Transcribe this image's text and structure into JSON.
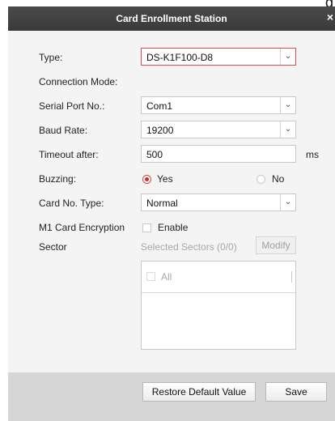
{
  "corner_glyph": "g",
  "dialog": {
    "title": "Card Enrollment Station",
    "close_glyph": "×"
  },
  "form": {
    "type": {
      "label": "Type:",
      "value": "DS-K1F100-D8"
    },
    "connection_mode": {
      "label": "Connection Mode:"
    },
    "serial_port": {
      "label": "Serial Port No.:",
      "value": "Com1"
    },
    "baud_rate": {
      "label": "Baud Rate:",
      "value": "19200"
    },
    "timeout": {
      "label": "Timeout after:",
      "value": "500",
      "unit": "ms"
    },
    "buzzing": {
      "label": "Buzzing:",
      "yes": "Yes",
      "no": "No",
      "selected": "Yes"
    },
    "card_no_type": {
      "label": "Card No. Type:",
      "value": "Normal"
    },
    "m1_encryption": {
      "label": "M1 Card Encryption",
      "option": "Enable",
      "checked": false
    },
    "sector": {
      "label": "Sector",
      "selected_text": "Selected Sectors (0/0)",
      "modify_label": "Modify",
      "all_label": "All"
    }
  },
  "footer": {
    "restore_label": "Restore Default Value",
    "save_label": "Save"
  },
  "colors": {
    "titlebar": "#3f3f3f",
    "active_border": "#e04a4a",
    "radio_selected": "#d42a2a",
    "footer": "#d6d6d6"
  },
  "icons": {
    "dropdown": "chevron-down-icon",
    "close": "close-icon"
  }
}
